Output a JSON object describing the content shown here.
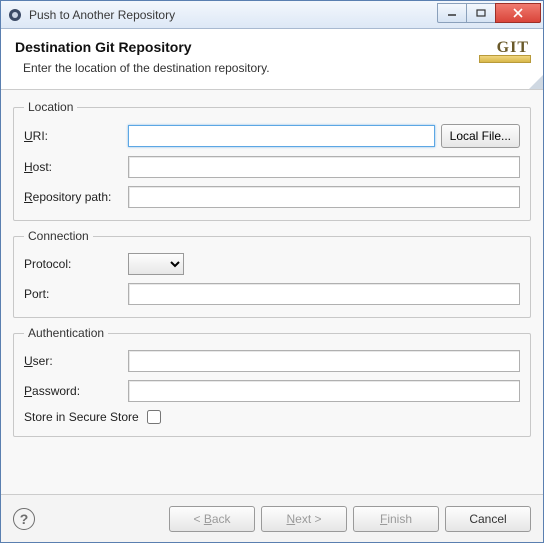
{
  "window": {
    "title": "Push to Another Repository"
  },
  "header": {
    "title": "Destination Git Repository",
    "subtitle": "Enter the location of the destination repository.",
    "logo": "GIT"
  },
  "location": {
    "legend": "Location",
    "uri_label": "URI:",
    "uri_value": "",
    "local_file_btn": "Local File...",
    "host_label": "Host:",
    "host_value": "",
    "repo_label": "Repository path:",
    "repo_value": ""
  },
  "connection": {
    "legend": "Connection",
    "protocol_label": "Protocol:",
    "protocol_value": "",
    "port_label": "Port:",
    "port_value": ""
  },
  "auth": {
    "legend": "Authentication",
    "user_label": "User:",
    "user_value": "",
    "password_label": "Password:",
    "password_value": "",
    "store_label": "Store in Secure Store",
    "store_checked": false
  },
  "footer": {
    "back": "< Back",
    "next": "Next >",
    "finish": "Finish",
    "cancel": "Cancel"
  }
}
